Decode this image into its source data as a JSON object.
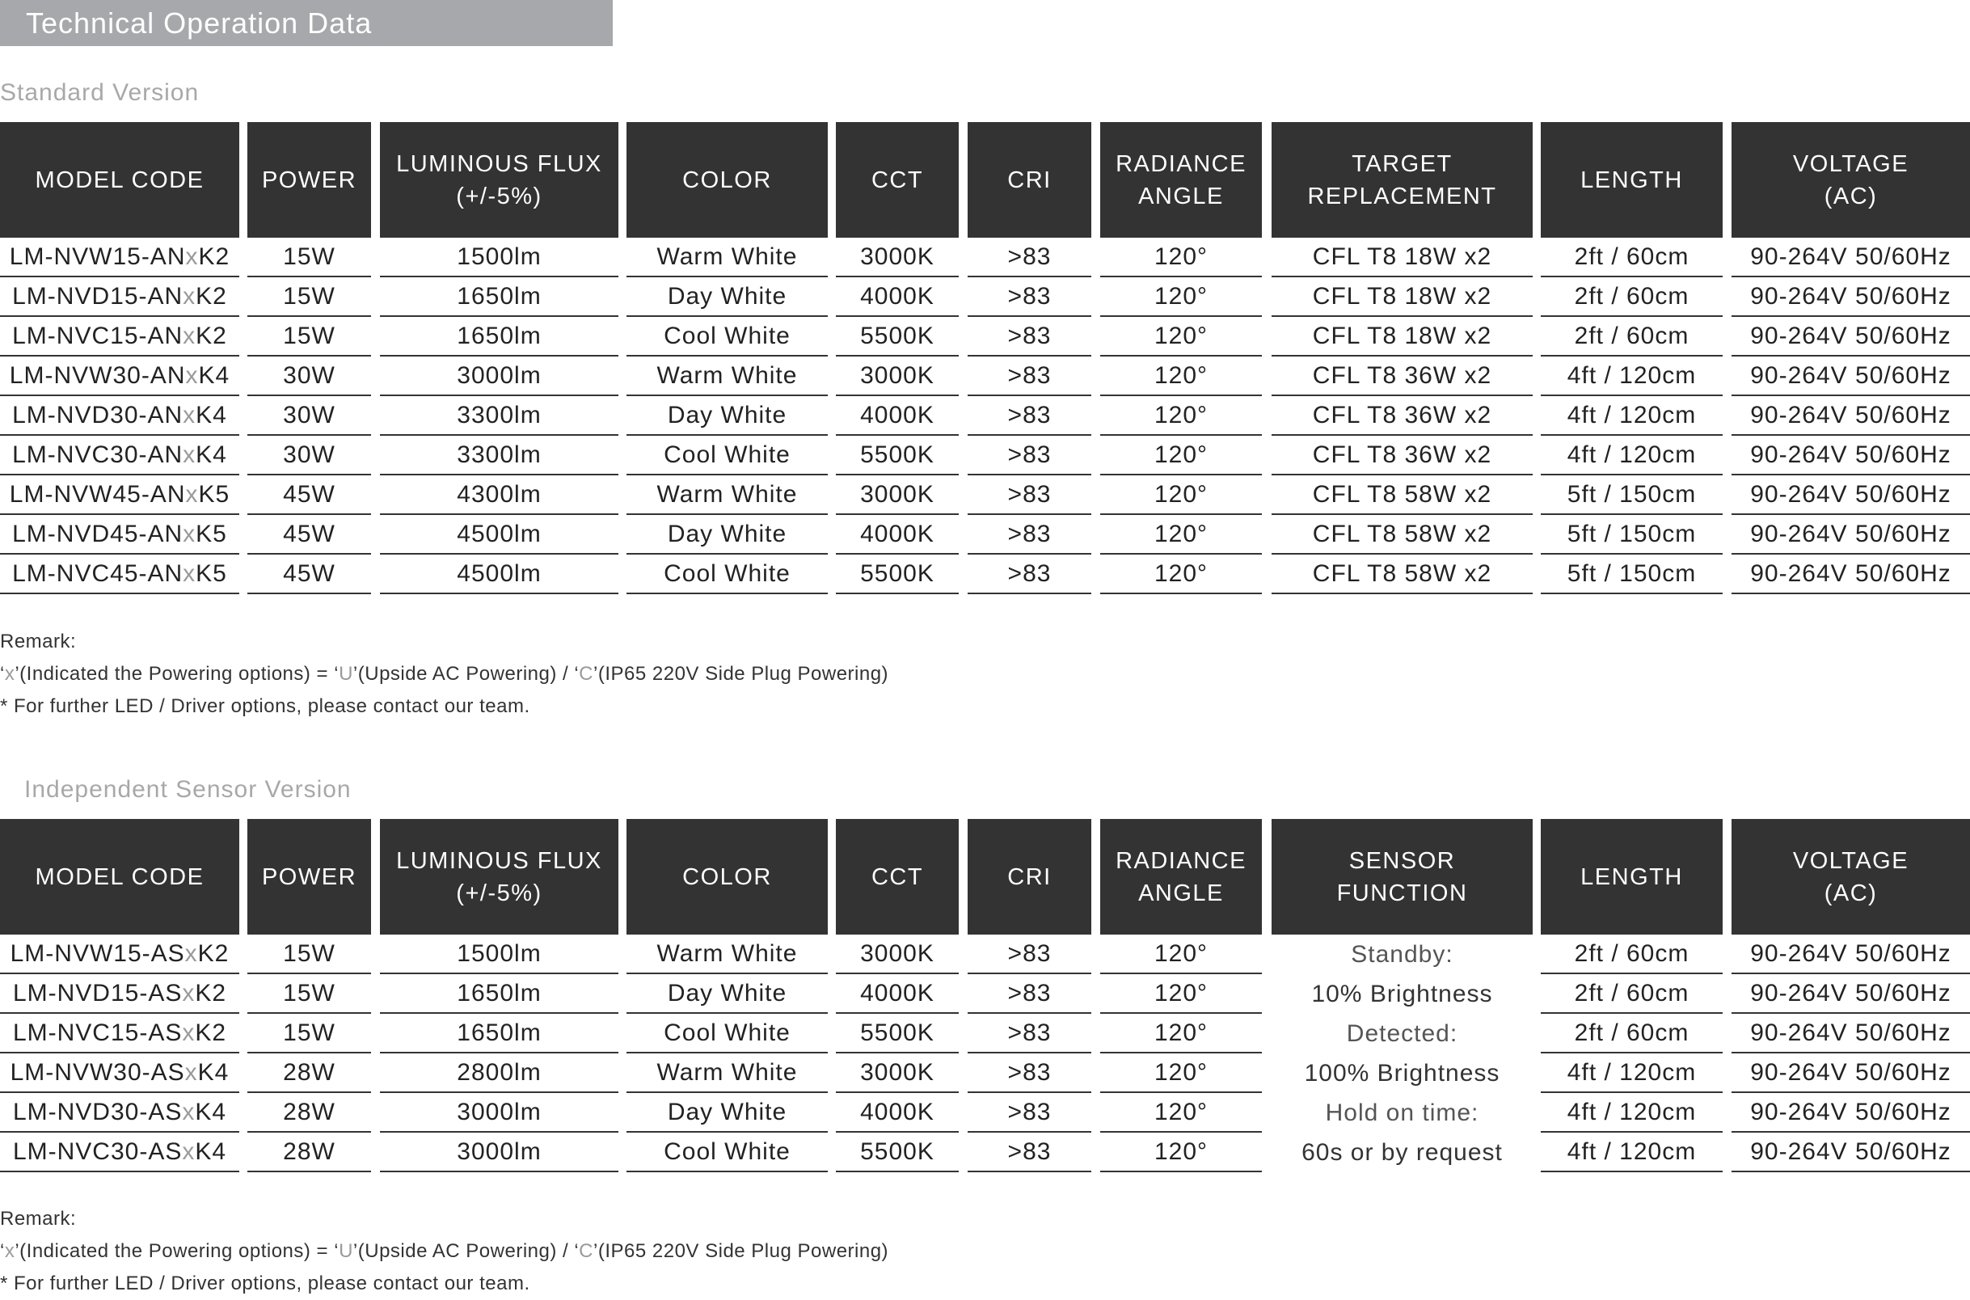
{
  "title": "Technical Operation Data",
  "standard": {
    "label": "Standard Version",
    "headers": [
      "MODEL CODE",
      "POWER",
      "LUMINOUS FLUX\n(+/-5%)",
      "COLOR",
      "CCT",
      "CRI",
      "RADIANCE\nANGLE",
      "TARGET\nREPLACEMENT",
      "LENGTH",
      "VOLTAGE\n(AC)"
    ],
    "rows": [
      {
        "model_a": "LM-NVW15-AN",
        "model_x": "x",
        "model_b": "K2",
        "power": "15W",
        "flux": "1500lm",
        "color": "Warm White",
        "cct": "3000K",
        "cri": ">83",
        "angle": "120°",
        "target": "CFL T8 18W x2",
        "length": "2ft / 60cm",
        "voltage": "90-264V 50/60Hz"
      },
      {
        "model_a": "LM-NVD15-AN",
        "model_x": "x",
        "model_b": "K2",
        "power": "15W",
        "flux": "1650lm",
        "color": "Day White",
        "cct": "4000K",
        "cri": ">83",
        "angle": "120°",
        "target": "CFL T8 18W x2",
        "length": "2ft / 60cm",
        "voltage": "90-264V 50/60Hz"
      },
      {
        "model_a": "LM-NVC15-AN",
        "model_x": "x",
        "model_b": "K2",
        "power": "15W",
        "flux": "1650lm",
        "color": "Cool White",
        "cct": "5500K",
        "cri": ">83",
        "angle": "120°",
        "target": "CFL T8 18W x2",
        "length": "2ft / 60cm",
        "voltage": "90-264V 50/60Hz"
      },
      {
        "model_a": "LM-NVW30-AN",
        "model_x": "x",
        "model_b": "K4",
        "power": "30W",
        "flux": "3000lm",
        "color": "Warm White",
        "cct": "3000K",
        "cri": ">83",
        "angle": "120°",
        "target": "CFL T8 36W x2",
        "length": "4ft / 120cm",
        "voltage": "90-264V 50/60Hz"
      },
      {
        "model_a": "LM-NVD30-AN",
        "model_x": "x",
        "model_b": "K4",
        "power": "30W",
        "flux": "3300lm",
        "color": "Day White",
        "cct": "4000K",
        "cri": ">83",
        "angle": "120°",
        "target": "CFL T8 36W x2",
        "length": "4ft / 120cm",
        "voltage": "90-264V 50/60Hz"
      },
      {
        "model_a": "LM-NVC30-AN",
        "model_x": "x",
        "model_b": "K4",
        "power": "30W",
        "flux": "3300lm",
        "color": "Cool White",
        "cct": "5500K",
        "cri": ">83",
        "angle": "120°",
        "target": "CFL T8 36W x2",
        "length": "4ft / 120cm",
        "voltage": "90-264V 50/60Hz"
      },
      {
        "model_a": "LM-NVW45-AN",
        "model_x": "x",
        "model_b": "K5",
        "power": "45W",
        "flux": "4300lm",
        "color": "Warm White",
        "cct": "3000K",
        "cri": ">83",
        "angle": "120°",
        "target": "CFL T8 58W x2",
        "length": "5ft / 150cm",
        "voltage": "90-264V 50/60Hz"
      },
      {
        "model_a": "LM-NVD45-AN",
        "model_x": "x",
        "model_b": "K5",
        "power": "45W",
        "flux": "4500lm",
        "color": "Day White",
        "cct": "4000K",
        "cri": ">83",
        "angle": "120°",
        "target": "CFL T8 58W x2",
        "length": "5ft / 150cm",
        "voltage": "90-264V 50/60Hz"
      },
      {
        "model_a": "LM-NVC45-AN",
        "model_x": "x",
        "model_b": "K5",
        "power": "45W",
        "flux": "4500lm",
        "color": "Cool White",
        "cct": "5500K",
        "cri": ">83",
        "angle": "120°",
        "target": "CFL T8 58W x2",
        "length": "5ft / 150cm",
        "voltage": "90-264V 50/60Hz"
      }
    ],
    "remark": {
      "heading": "Remark:",
      "line1": [
        "‘",
        "x",
        "’(Indicated the Powering options) = ‘",
        "U",
        "’(Upside AC Powering) / ‘",
        "C",
        "’(IP65 220V Side Plug Powering)"
      ],
      "line2": "* For further LED / Driver options, please contact our team."
    }
  },
  "sensor": {
    "label": "Independent Sensor Version",
    "headers": [
      "MODEL CODE",
      "POWER",
      "LUMINOUS FLUX\n(+/-5%)",
      "COLOR",
      "CCT",
      "CRI",
      "RADIANCE\nANGLE",
      "SENSOR\nFUNCTION",
      "LENGTH",
      "VOLTAGE\n(AC)"
    ],
    "rows": [
      {
        "model_a": "LM-NVW15-AS",
        "model_x": "x",
        "model_b": "K2",
        "power": "15W",
        "flux": "1500lm",
        "color": "Warm White",
        "cct": "3000K",
        "cri": ">83",
        "angle": "120°",
        "length": "2ft / 60cm",
        "voltage": "90-264V 50/60Hz"
      },
      {
        "model_a": "LM-NVD15-AS",
        "model_x": "x",
        "model_b": "K2",
        "power": "15W",
        "flux": "1650lm",
        "color": "Day White",
        "cct": "4000K",
        "cri": ">83",
        "angle": "120°",
        "length": "2ft / 60cm",
        "voltage": "90-264V 50/60Hz"
      },
      {
        "model_a": "LM-NVC15-AS",
        "model_x": "x",
        "model_b": "K2",
        "power": "15W",
        "flux": "1650lm",
        "color": "Cool White",
        "cct": "5500K",
        "cri": ">83",
        "angle": "120°",
        "length": "2ft / 60cm",
        "voltage": "90-264V 50/60Hz"
      },
      {
        "model_a": "LM-NVW30-AS",
        "model_x": "x",
        "model_b": "K4",
        "power": "28W",
        "flux": "2800lm",
        "color": "Warm White",
        "cct": "3000K",
        "cri": ">83",
        "angle": "120°",
        "length": "4ft / 120cm",
        "voltage": "90-264V 50/60Hz"
      },
      {
        "model_a": "LM-NVD30-AS",
        "model_x": "x",
        "model_b": "K4",
        "power": "28W",
        "flux": "3000lm",
        "color": "Day White",
        "cct": "4000K",
        "cri": ">83",
        "angle": "120°",
        "length": "4ft / 120cm",
        "voltage": "90-264V 50/60Hz"
      },
      {
        "model_a": "LM-NVC30-AS",
        "model_x": "x",
        "model_b": "K4",
        "power": "28W",
        "flux": "3000lm",
        "color": "Cool White",
        "cct": "5500K",
        "cri": ">83",
        "angle": "120°",
        "length": "4ft / 120cm",
        "voltage": "90-264V 50/60Hz"
      }
    ],
    "sensor_function": [
      "Standby:",
      "10% Brightness",
      "Detected:",
      "100% Brightness",
      "Hold on time:",
      "60s or by request"
    ],
    "remark": {
      "heading": "Remark:",
      "line1": [
        "‘",
        "x",
        "’(Indicated the Powering options) = ‘",
        "U",
        "’(Upside AC Powering) / ‘",
        "C",
        "’(IP65 220V Side Plug Powering)"
      ],
      "line2": "* For further LED / Driver options, please contact our team."
    }
  }
}
